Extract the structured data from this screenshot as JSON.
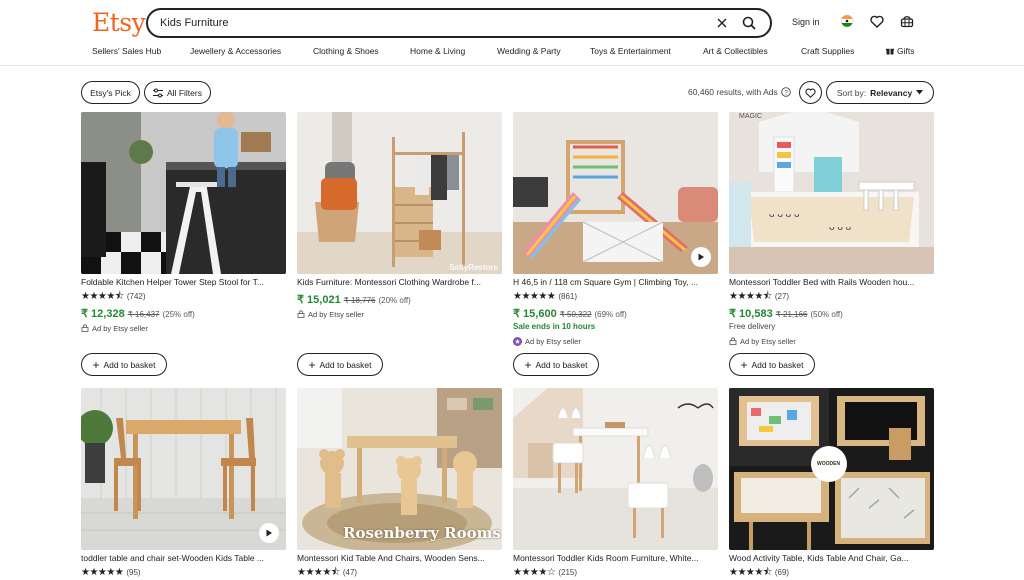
{
  "header": {
    "logo": "Etsy",
    "search_value": "Kids  Furniture",
    "signin": "Sign in"
  },
  "nav": [
    "Sellers' Sales Hub",
    "Jewellery & Accessories",
    "Clothing & Shoes",
    "Home & Living",
    "Wedding & Party",
    "Toys & Entertainment",
    "Art & Collectibles",
    "Craft Supplies",
    "Gifts"
  ],
  "filters": {
    "etsys_pick": "Etsy's Pick",
    "all_filters": "All Filters",
    "results": "60,460 results, with Ads",
    "sort_label": "Sort by:",
    "sort_value": "Relevancy"
  },
  "add_to_basket": "Add to basket",
  "ad_text": "Ad by Etsy seller",
  "products": [
    {
      "title": "Foldable Kitchen Helper Tower Step Stool for T...",
      "stars": "★★★★⯪",
      "count": "(742)",
      "price": "₹ 12,328",
      "old_price": "₹ 16,437",
      "discount": "(25% off)"
    },
    {
      "title": "Kids Furniture: Montessori Clothing Wardrobe f...",
      "stars": "★★★★★",
      "count": "",
      "price": "₹ 15,021",
      "old_price": "₹ 18,776",
      "discount": "(20% off)",
      "watermark": "SaltyRestore"
    },
    {
      "title": "H 46,5 in / 118 cm Square Gym | Climbing Toy, ...",
      "stars": "★★★★★",
      "count": "(861)",
      "price": "₹ 15,600",
      "old_price": "₹ 50,322",
      "discount": "(69% off)",
      "sale": "Sale ends in 10 hours"
    },
    {
      "title": "Montessori Toddler Bed with Rails Wooden hou...",
      "stars": "★★★★⯪",
      "count": "(27)",
      "price": "₹ 10,583",
      "old_price": "₹ 21,166",
      "discount": "(50% off)",
      "free": "Free delivery",
      "image_text": "MAGIC"
    },
    {
      "title": "toddler table and chair set-Wooden Kids Table ...",
      "stars": "★★★★★",
      "count": "(95)"
    },
    {
      "title": "Montessori Kid Table And Chairs, Wooden Sens...",
      "stars": "★★★★⯪",
      "count": "(47)",
      "watermark": "Rosenberry Rooms"
    },
    {
      "title": "Montessori Toddler Kids Room Furniture, White...",
      "stars": "★★★★☆",
      "count": "(215)"
    },
    {
      "title": "Wood Activity Table, Kids Table And Chair, Ga...",
      "stars": "★★★★⯪",
      "count": "(69)",
      "badge": "WOODEN"
    }
  ],
  "colors": {
    "brand": "#f1641e",
    "sale_green": "#258635"
  }
}
